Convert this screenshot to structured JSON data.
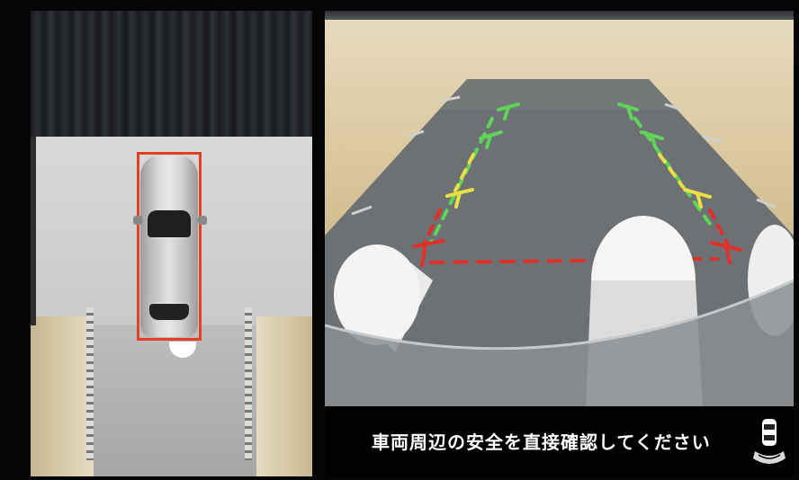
{
  "camera_views": {
    "left": "top-down surround view",
    "right": "rear camera view"
  },
  "guide_line_colors": {
    "near": "#e0302a",
    "mid": "#e8e046",
    "far": "#5fd35a"
  },
  "message": {
    "text": "車両周辺の安全を直接確認してください"
  },
  "icons": {
    "sensor_status": "car-sensor-icon"
  }
}
